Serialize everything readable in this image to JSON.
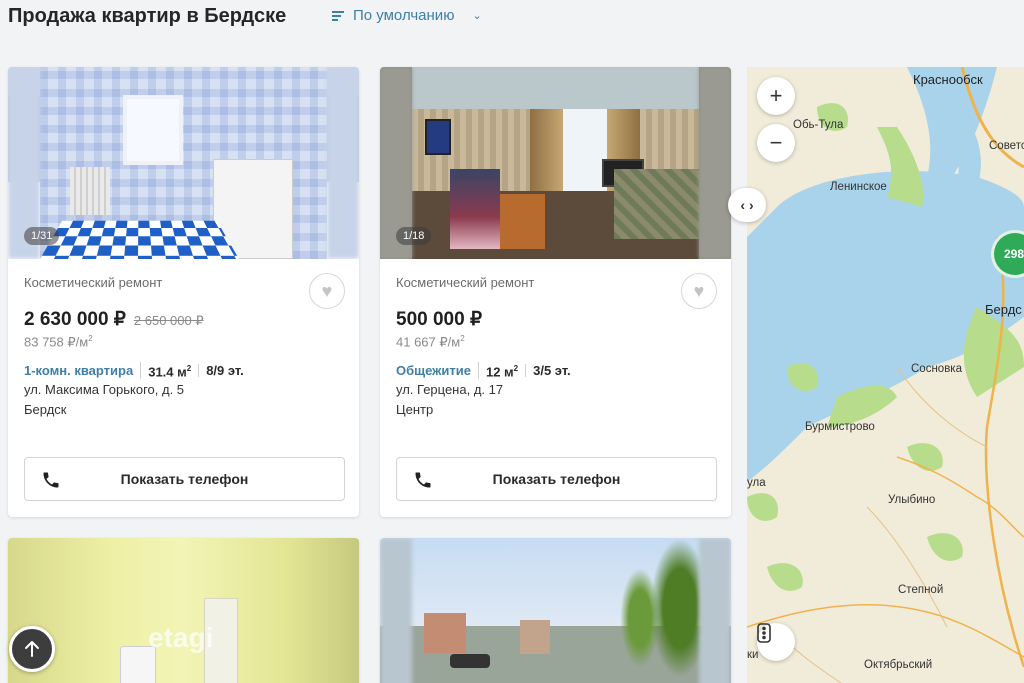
{
  "header": {
    "title": "Продажа квартир в Бердске",
    "sort_label": "По умолчанию"
  },
  "listings": [
    {
      "photo_counter": "1/31",
      "repair": "Косметический ремонт",
      "price": "2 630 000 ₽",
      "old_price": "2 650 000 ₽",
      "price_per_m": "83 758 ₽/м",
      "type": "1-комн. квартира",
      "area": "31.4 м",
      "floor": "8/9 эт.",
      "address": "ул. Максима Горького, д. 5",
      "district": "Бердск",
      "phone_label": "Показать телефон"
    },
    {
      "photo_counter": "1/18",
      "repair": "Косметический ремонт",
      "price": "500 000 ₽",
      "old_price": "",
      "price_per_m": "41 667 ₽/м",
      "type": "Общежитие",
      "area": "12 м",
      "floor": "3/5 эт.",
      "address": "ул. Герцена, д. 17",
      "district": "Центр",
      "phone_label": "Показать телефон"
    },
    {
      "watermark": "etagi"
    },
    {}
  ],
  "map": {
    "zoom_in": "+",
    "zoom_out": "−",
    "cluster_count": "298",
    "labels": {
      "krasnoobsk": "Краснообск",
      "ob_tula": "Обь-Тула",
      "sovetsky": "Советс",
      "leninskoe": "Ленинское",
      "berdsk": "Бердс",
      "sosnovka": "Сосновка",
      "burmistrovo": "Бурмистрово",
      "tula": "ула",
      "ulybino": "Улыбино",
      "stepnoy": "Степной",
      "oktyabrsky": "Октябрьский",
      "ki": "ки"
    },
    "colors": {
      "water": "#a9d3ea",
      "land": "#f1ecd9",
      "green": "#b7dc8c",
      "road": "#f0b24c"
    }
  },
  "controls": {
    "slider_toggle": "‹ ›"
  }
}
